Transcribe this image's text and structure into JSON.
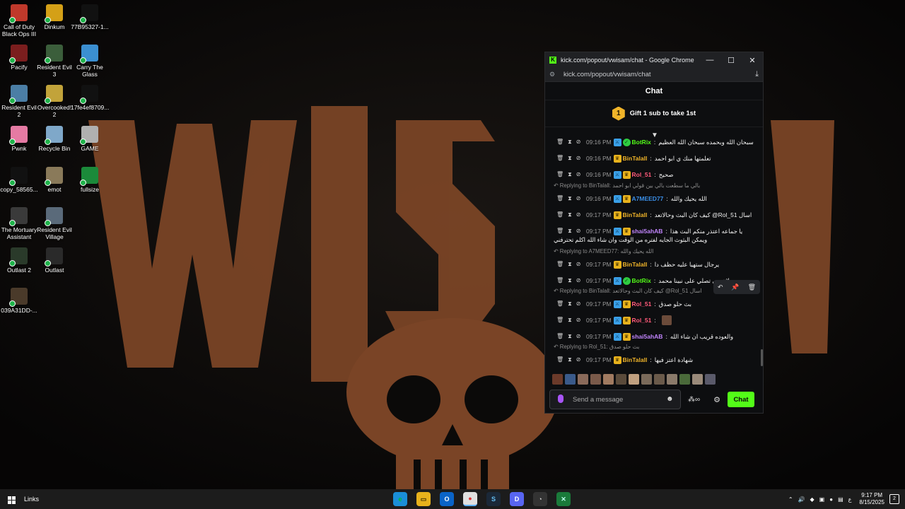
{
  "desktop": {
    "icons": [
      {
        "label": "Call of Duty Black Ops III",
        "color": "#c0392b"
      },
      {
        "label": "Dinkum",
        "color": "#d4a017"
      },
      {
        "label": "77B95327-1...",
        "color": "#111111"
      },
      {
        "label": "Pacify",
        "color": "#7b1e1e"
      },
      {
        "label": "Resident Evil 3",
        "color": "#3b5e3b"
      },
      {
        "label": "Carry The Glass",
        "color": "#3b8fd1"
      },
      {
        "label": "Resident Evil 2",
        "color": "#4b7ea5"
      },
      {
        "label": "Overcooked! 2",
        "color": "#c2a33a"
      },
      {
        "label": "17fe4ef8709...",
        "color": "#111111"
      },
      {
        "label": "Pwnk",
        "color": "#e57aa3"
      },
      {
        "label": "Recycle Bin",
        "color": "#7fa8c9"
      },
      {
        "label": "GAME",
        "color": "#b0b0b0"
      },
      {
        "label": "copy_58565...",
        "color": "#111111"
      },
      {
        "label": "emot",
        "color": "#8a7a5a"
      },
      {
        "label": "fullsize",
        "color": "#1b8a3a"
      },
      {
        "label": "The Mortuary Assistant",
        "color": "#3a3a3a"
      },
      {
        "label": "Resident Evil Village",
        "color": "#5a6a7a"
      },
      {
        "label": "Outlast 2",
        "color": "#2a3a2a"
      },
      {
        "label": "Outlast",
        "color": "#2a2a2a"
      },
      {
        "label": "039A31DD-...",
        "color": "#4a3a2a"
      }
    ]
  },
  "window": {
    "title": "kick.com/popout/vwisam/chat - Google Chrome",
    "url": "kick.com/popout/vwisam/chat",
    "minimize": "—",
    "maximize": "☐",
    "close": "✕"
  },
  "chat": {
    "header": "Chat",
    "gift_number": "1",
    "gift_text": "Gift 1 sub to take 1st",
    "input_placeholder": "Send a message",
    "send_label": "Chat",
    "credits_icon": "∞",
    "messages": [
      {
        "time": "09:16 PM",
        "user": "BotRix",
        "user_color": "#53fc18",
        "badges": [
          "blue",
          "green"
        ],
        "text": "سبحان الله وبحمده سبحان الله العظيم"
      },
      {
        "time": "09:16 PM",
        "user": "BinTalall",
        "user_color": "#f0b429",
        "badges": [
          "gold"
        ],
        "text": "تعلمتها منك ي ابو احمد"
      },
      {
        "time": "09:16 PM",
        "user": "Rol_51",
        "user_color": "#ff5a7a",
        "badges": [
          "blue",
          "gold"
        ],
        "text": "صحيح"
      },
      {
        "time": "09:16 PM",
        "user": "A7MEED77",
        "user_color": "#3a8ee6",
        "badges": [
          "blue",
          "gold"
        ],
        "text": "الله يحيك والله"
      },
      {
        "time": "09:17 PM",
        "user": "BinTalall",
        "user_color": "#f0b429",
        "badges": [
          "gold"
        ],
        "text": "كيف كان البث وحالاتعد @Rol_51 اسال"
      },
      {
        "time": "09:17 PM",
        "user": "shai5ahAB",
        "user_color": "#c084fc",
        "badges": [
          "blue",
          "gold"
        ],
        "text": "يا جماعه اعتذر منكم البث هذا"
      },
      {
        "time": "09:17 PM",
        "user": "BinTalall",
        "user_color": "#f0b429",
        "badges": [
          "gold"
        ],
        "text": "يرجال ستهيا عليه حظف دا"
      },
      {
        "time": "09:17 PM",
        "user": "BotRix",
        "user_color": "#53fc18",
        "badges": [
          "blue",
          "green"
        ],
        "text": "لاتنسى تصلي على نبينا محمد"
      },
      {
        "time": "09:17 PM",
        "user": "Rol_51",
        "user_color": "#ff5a7a",
        "badges": [
          "blue",
          "gold"
        ],
        "text": "بث حلو صدق"
      },
      {
        "time": "09:17 PM",
        "user": "Rol_51",
        "user_color": "#ff5a7a",
        "badges": [
          "blue",
          "gold"
        ],
        "text": ""
      },
      {
        "time": "09:17 PM",
        "user": "shai5ahAB",
        "user_color": "#c084fc",
        "badges": [
          "blue",
          "gold"
        ],
        "text": "والعوده قريب ان شاء الله"
      },
      {
        "time": "09:17 PM",
        "user": "BinTalall",
        "user_color": "#f0b429",
        "badges": [
          "gold"
        ],
        "text": "شهادة اعتز فيها"
      }
    ],
    "continuation": "ويمكن البثوث الجايه لفتره من الوقت وان شاء الله اكلم تحترفني",
    "replies": [
      {
        "text": "Replying to BinTalall:  بالي ما سطعت بالي بين قولي ابو احمد"
      },
      {
        "text": "Replying to A7MEED77:  الله يحيك والله"
      },
      {
        "text": "Replying to BinTalall:  كيف كان البث وحالاتعد @Rol_51 اسال"
      },
      {
        "text": "Replying to Rol_51:  بث حلو صدق"
      }
    ]
  },
  "taskbar": {
    "links": "Links",
    "time": "9:17 PM",
    "date": "8/15/2025",
    "lang": "ع",
    "notifications": "2"
  }
}
